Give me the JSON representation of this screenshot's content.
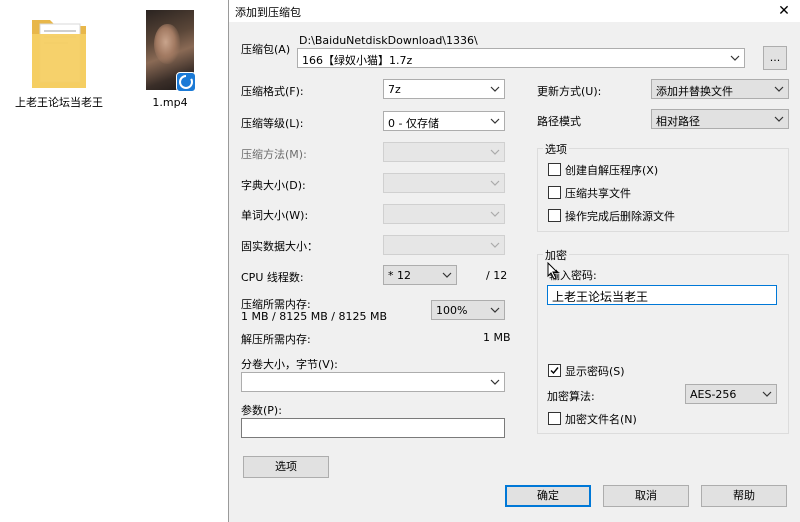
{
  "desktop": {
    "folder_label": "上老王论坛当老王",
    "video_label": "1.mp4"
  },
  "dialog": {
    "title": "添加到压缩包",
    "close_glyph": "✕",
    "archive": {
      "label": "压缩包(A)",
      "path": "D:\\BaiduNetdiskDownload\\1336\\",
      "filename": "166【绿奴小猫】1.7z",
      "browse_label": "..."
    },
    "left": {
      "format_label": "压缩格式(F):",
      "format_value": "7z",
      "level_label": "压缩等级(L):",
      "level_value": "0 - 仅存储",
      "method_label": "压缩方法(M):",
      "dict_label": "字典大小(D):",
      "word_label": "单词大小(W):",
      "solid_label": "固实数据大小：",
      "cpu_label": "CPU 线程数:",
      "cpu_value": "* 12",
      "cpu_total": "/ 12",
      "mem_label": "压缩所需内存:",
      "mem_detail": "1 MB / 8125 MB / 8125 MB",
      "mem_percent": "100%",
      "decomp_label": "解压所需内存:",
      "decomp_value": "1 MB",
      "volume_label": "分卷大小，字节(V):",
      "volume_value": "",
      "params_label": "参数(P):",
      "params_value": "",
      "options_button": "选项"
    },
    "right": {
      "update_label": "更新方式(U):",
      "update_value": "添加并替换文件",
      "path_label": "路径模式",
      "path_value": "相对路径",
      "options_group": "选项",
      "opt_sfx": "创建自解压程序(X)",
      "opt_shared": "压缩共享文件",
      "opt_delete": "操作完成后删除源文件",
      "encrypt_group": "加密",
      "password_label": "输入密码:",
      "password_value": "上老王论坛当老王",
      "show_password": "显示密码(S)",
      "enc_method_label": "加密算法:",
      "enc_method_value": "AES-256",
      "encrypt_names": "加密文件名(N)"
    },
    "buttons": {
      "ok": "确定",
      "cancel": "取消",
      "help": "帮助"
    }
  }
}
